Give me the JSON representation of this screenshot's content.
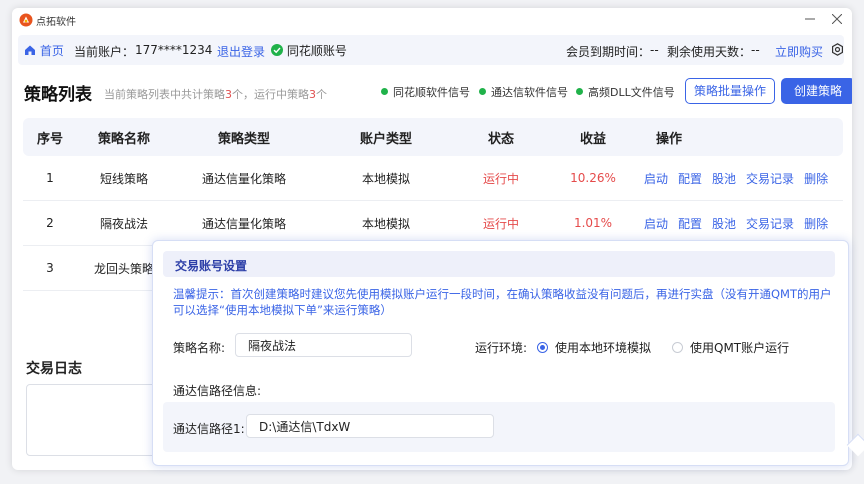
{
  "app": {
    "title": "点拓软件"
  },
  "infobar": {
    "home": "首页",
    "account_label": "当前账户：",
    "account_value": "177****1234",
    "logout": "退出登录",
    "linked_account": "同花顺账号",
    "expire_label": "会员到期时间：",
    "expire_value": "--",
    "remain_label": "剩余使用天数：",
    "remain_value": "--",
    "buy": "立即购买"
  },
  "page": {
    "title": "策略列表",
    "sub_prefix": "当前策略列表中共计策略",
    "total": "3",
    "sub_mid": "个，运行中策略",
    "running": "3",
    "sub_suffix": "个",
    "signals": [
      "同花顺软件信号",
      "通达信软件信号",
      "高频DLL文件信号"
    ],
    "batch_button": "策略批量操作",
    "create_button": "创建策略"
  },
  "table": {
    "headers": [
      "序号",
      "策略名称",
      "策略类型",
      "账户类型",
      "状态",
      "收益",
      "操作"
    ],
    "rows": [
      {
        "index": "1",
        "name": "短线策略",
        "type": "通达信量化策略",
        "account": "本地模拟",
        "status": "运行中",
        "profit": "10.26%"
      },
      {
        "index": "2",
        "name": "隔夜战法",
        "type": "通达信量化策略",
        "account": "本地模拟",
        "status": "运行中",
        "profit": "1.01%"
      },
      {
        "index": "3",
        "name": "龙回头策略"
      }
    ],
    "actions": [
      "启动",
      "配置",
      "股池",
      "交易记录",
      "删除"
    ]
  },
  "log": {
    "title": "交易日志"
  },
  "popup": {
    "title": "交易账号设置",
    "tip_line1": "温馨提示：首次创建策略时建议您先使用模拟账户运行一段时间，在确认策略收益没有问题后，再进行实盘（没有开通QMT的用户",
    "tip_line2": "可以选择“使用本地模拟下单”来运行策略）",
    "name_label": "策略名称:",
    "name_value": "隔夜战法",
    "env_label": "运行环境:",
    "env_options": [
      "使用本地环境模拟",
      "使用QMT账户运行"
    ],
    "env_selected": "使用本地环境模拟",
    "path_section": "通达信路径信息:",
    "path_label": "通达信路径1:",
    "path_value": "D:\\通达信\\TdxW"
  },
  "colors": {
    "accent": "#3a64e6",
    "status_red": "#e54b4b",
    "signal_green": "#20b24a"
  }
}
